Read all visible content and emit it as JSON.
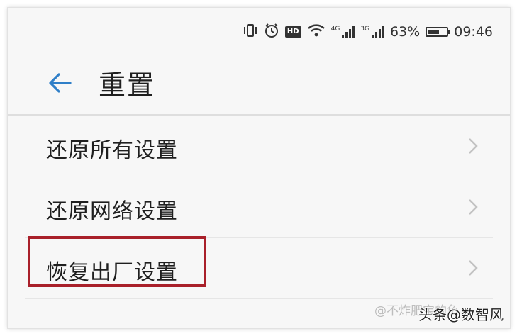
{
  "status_bar": {
    "battery_percent": "63%",
    "battery_level": 0.63,
    "time": "09:46",
    "hd_label": "HD",
    "net1": "4G",
    "net2": "3G",
    "icons": [
      "vibrate-icon",
      "alarm-icon",
      "hd-icon",
      "wifi-icon",
      "signal-icon",
      "signal-icon",
      "battery-icon"
    ]
  },
  "header": {
    "title": "重置",
    "back_icon": "back-arrow-icon",
    "accent_color": "#2f7fc8"
  },
  "list": {
    "items": [
      {
        "label": "还原所有设置"
      },
      {
        "label": "还原网络设置"
      },
      {
        "label": "恢复出厂设置"
      }
    ]
  },
  "highlight_color": "#a9202a",
  "watermark": {
    "text_a": "@不炸肥宝的鱼",
    "text_b": "头条@数智风"
  }
}
